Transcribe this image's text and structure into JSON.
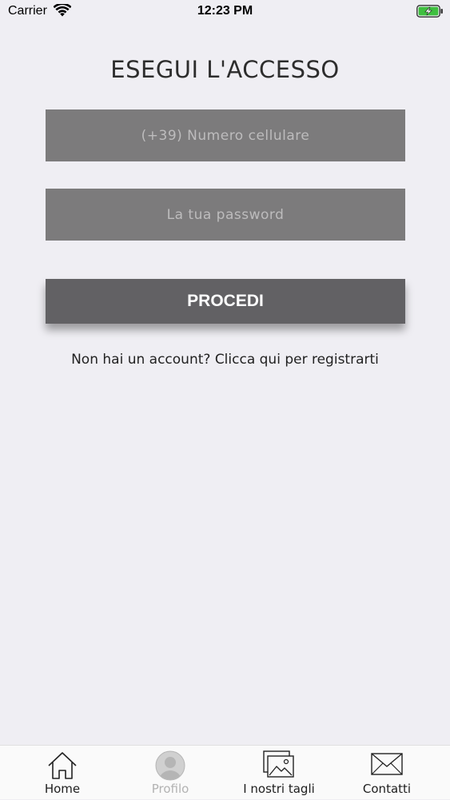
{
  "status_bar": {
    "carrier": "Carrier",
    "time": "12:23 PM",
    "battery_color": "#3fbf3f"
  },
  "login": {
    "title": "ESEGUI L'ACCESSO",
    "phone_placeholder": "(+39) Numero cellulare",
    "password_placeholder": "La tua password",
    "submit_label": "PROCEDI",
    "register_text": "Non hai un account? Clicca qui per registrarti"
  },
  "tabs": [
    {
      "label": "Home",
      "icon": "home-icon",
      "active": true
    },
    {
      "label": "Profilo",
      "icon": "profile-icon",
      "active": false
    },
    {
      "label": "I nostri tagli",
      "icon": "gallery-icon",
      "active": true
    },
    {
      "label": "Contatti",
      "icon": "mail-icon",
      "active": true
    }
  ],
  "colors": {
    "background": "#efeef3",
    "field": "#7c7b7c",
    "button": "#626164"
  }
}
